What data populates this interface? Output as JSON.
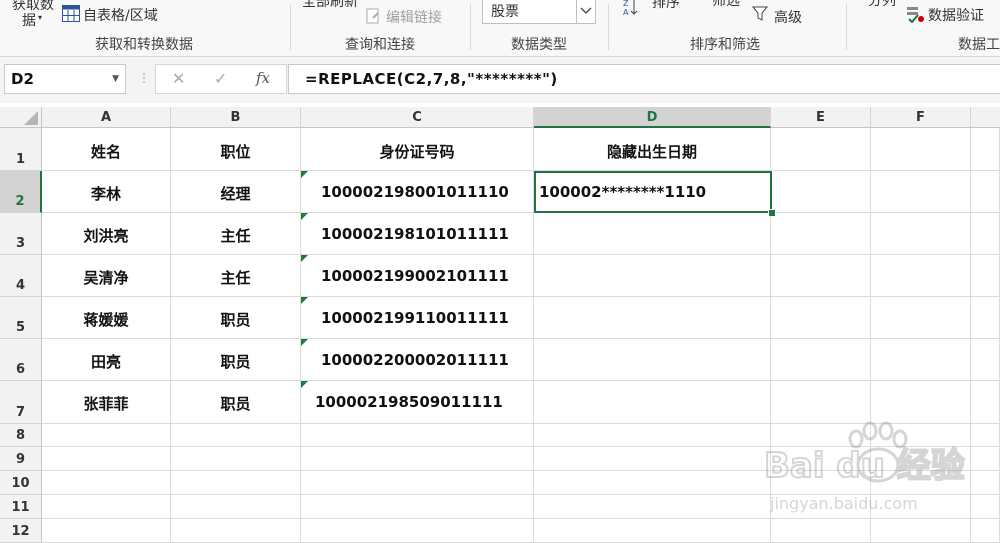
{
  "ribbon": {
    "get_data_label_line1": "获取数",
    "get_data_label_line2": "据",
    "from_table_label": "自表格/区域",
    "refresh_all_label": "全部刷新",
    "edit_links_label": "编辑链接",
    "data_type_value": "股票",
    "sort_label": "排序",
    "filter_label": "筛选",
    "advanced_label": "高级",
    "split_label": "分列",
    "validation_label": "数据验证",
    "groups": {
      "get_transform": "获取和转换数据",
      "queries": "查询和连接",
      "data_types": "数据类型",
      "sort_filter": "排序和筛选",
      "data_tools": "数据工"
    }
  },
  "formula_bar": {
    "name_box": "D2",
    "fx_label": "fx",
    "cancel_glyph": "✕",
    "enter_glyph": "✓",
    "formula": "=REPLACE(C2,7,8,\"********\")"
  },
  "columns": [
    "A",
    "B",
    "C",
    "D",
    "E",
    "F"
  ],
  "rows": [
    "1",
    "2",
    "3",
    "4",
    "5",
    "6",
    "7",
    "8",
    "9",
    "10",
    "11",
    "12"
  ],
  "table": {
    "headers": [
      "姓名",
      "职位",
      "身份证号码",
      "隐藏出生日期"
    ],
    "records": [
      {
        "name": "李林",
        "position": "经理",
        "id": "100002198001011110",
        "hidden": "100002********1110"
      },
      {
        "name": "刘洪亮",
        "position": "主任",
        "id": "100002198101011111",
        "hidden": ""
      },
      {
        "name": "吴清净",
        "position": "主任",
        "id": "100002199002101111",
        "hidden": ""
      },
      {
        "name": "蒋媛媛",
        "position": "职员",
        "id": "100002199110011111",
        "hidden": ""
      },
      {
        "name": "田亮",
        "position": "职员",
        "id": "100002200002011111",
        "hidden": ""
      },
      {
        "name": "张菲菲",
        "position": "职员",
        "id": "100002198509011111",
        "hidden": ""
      }
    ]
  },
  "selected_cell": "D2",
  "watermark": {
    "brand": "Bai du 经验",
    "url": "jingyan.baidu.com"
  },
  "colors": {
    "accent": "#217346",
    "error_triangle": "#1e7b3a"
  }
}
